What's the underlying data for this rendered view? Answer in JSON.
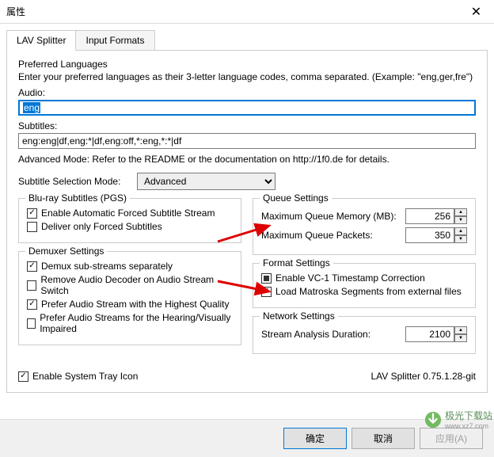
{
  "window": {
    "title": "属性"
  },
  "tabs": [
    {
      "label": "LAV Splitter",
      "active": true
    },
    {
      "label": "Input Formats",
      "active": false
    }
  ],
  "prefLang": {
    "heading": "Preferred Languages",
    "desc": "Enter your preferred languages as their 3-letter language codes, comma separated. (Example: \"eng,ger,fre\")",
    "audioLabel": "Audio:",
    "audioValue": "eng",
    "subsLabel": "Subtitles:",
    "subsValue": "eng:eng|df,eng:*|df,eng:off,*:eng,*:*|df",
    "advanced": "Advanced Mode: Refer to the README or the documentation on http://1f0.de for details."
  },
  "subtitleMode": {
    "label": "Subtitle Selection Mode:",
    "value": "Advanced"
  },
  "bluray": {
    "legend": "Blu-ray Subtitles (PGS)",
    "enableForced": "Enable Automatic Forced Subtitle Stream",
    "deliverOnly": "Deliver only Forced Subtitles"
  },
  "demuxer": {
    "legend": "Demuxer Settings",
    "demuxSub": "Demux sub-streams separately",
    "removeDecoder": "Remove Audio Decoder on Audio Stream Switch",
    "preferHQ": "Prefer Audio Stream with the Highest Quality",
    "preferImpaired": "Prefer Audio Streams for the Hearing/Visually Impaired"
  },
  "queue": {
    "legend": "Queue Settings",
    "memLabel": "Maximum Queue Memory (MB):",
    "memValue": "256",
    "packetsLabel": "Maximum Queue Packets:",
    "packetsValue": "350"
  },
  "format": {
    "legend": "Format Settings",
    "vc1": "Enable VC-1 Timestamp Correction",
    "matroska": "Load Matroska Segments from external files"
  },
  "network": {
    "legend": "Network Settings",
    "analysisLabel": "Stream Analysis Duration:",
    "analysisValue": "2100"
  },
  "trayIcon": "Enable System Tray Icon",
  "version": "LAV Splitter 0.75.1.28-git",
  "buttons": {
    "ok": "确定",
    "cancel": "取消",
    "apply": "应用(A)"
  },
  "watermark": {
    "text": "极光下载站",
    "url": "www.xz7.com"
  }
}
